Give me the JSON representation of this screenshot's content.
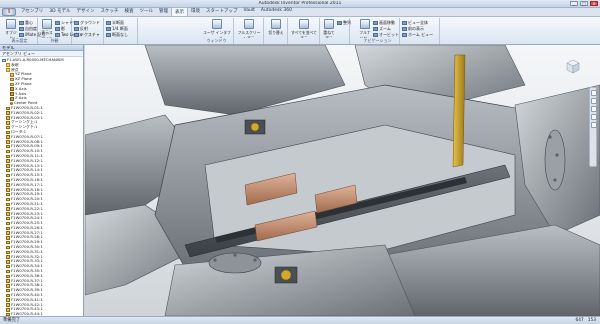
{
  "window": {
    "title": "Autodesk Inventor Professional 2011",
    "buttons": [
      "_",
      "□",
      "×"
    ]
  },
  "app_button": "I",
  "tabs": [
    "アセンブリ",
    "3D モデル",
    "デザイン",
    "スケッチ",
    "検査",
    "ツール",
    "管理",
    "表示",
    "環境",
    "スタートアップ",
    "Vault",
    "Autodesk 360"
  ],
  "active_tab": "表示",
  "ribbon": {
    "groups": [
      {
        "label": "表示設定",
        "big": "オブジェクトの可視性",
        "small": [
          "重心",
          "自由度",
          "iMate 記号"
        ]
      },
      {
        "label": "外観",
        "big": "表示スタイル",
        "small": [
          "シャドウ",
          "影",
          "Two Lights"
        ]
      },
      {
        "label": "",
        "big": "",
        "small": [
          "グラウンド",
          "反射",
          "テクスチャ"
        ]
      },
      {
        "label": "",
        "big": "",
        "small": [
          "半断面",
          "1/4 断面",
          "断面なし"
        ]
      },
      {
        "label": "ウィンドウ",
        "big": "ユーザ インタフェース",
        "small": []
      },
      {
        "label": "",
        "big": "フルスクリーン表示",
        "small": []
      },
      {
        "label": "",
        "big": "切り替え",
        "small": []
      },
      {
        "label": "",
        "big": "すべてを並べて表示",
        "small": []
      },
      {
        "label": "",
        "big": "重ねて表示",
        "small": [
          "整列"
        ]
      },
      {
        "label": "ナビゲーション",
        "big": "フルナビゲーションホイール",
        "small": [
          "画面移動",
          "ズーム",
          "オービット"
        ]
      },
      {
        "label": "",
        "big": "",
        "small": [
          "ビュー全体",
          "前の表示",
          "ホーム ビュー"
        ]
      }
    ]
  },
  "browser": {
    "title": "モデル",
    "view_selector": "アセンブリ ビュー",
    "tree": [
      {
        "label": "F1-kW1-A-R0000-MECHANISM",
        "icon": "assy",
        "indent": 0
      },
      {
        "label": "表現",
        "icon": "folder",
        "indent": 1
      },
      {
        "label": "原点",
        "icon": "folder",
        "indent": 1
      },
      {
        "label": "YZ Plane",
        "icon": "plane",
        "indent": 2
      },
      {
        "label": "XZ Plane",
        "icon": "plane",
        "indent": 2
      },
      {
        "label": "XY Plane",
        "icon": "plane",
        "indent": 2
      },
      {
        "label": "X Axis",
        "icon": "axis",
        "indent": 2
      },
      {
        "label": "Y Axis",
        "icon": "axis",
        "indent": 2
      },
      {
        "label": "Z Axis",
        "icon": "axis",
        "indent": 2
      },
      {
        "label": "Center Point",
        "icon": "point",
        "indent": 2
      },
      {
        "label": "F1W0700-R-01:1",
        "icon": "part",
        "indent": 1
      },
      {
        "label": "F1W0700-R-02:1",
        "icon": "part",
        "indent": 1
      },
      {
        "label": "F1W0700-R-03:1",
        "icon": "part",
        "indent": 1
      },
      {
        "label": "ケーシング上:1",
        "icon": "part",
        "indent": 1
      },
      {
        "label": "ケーシング下:1",
        "icon": "part",
        "indent": 1
      },
      {
        "label": "ロータ:1",
        "icon": "part",
        "indent": 1
      },
      {
        "label": "F1W0700-R-07:1",
        "icon": "part",
        "indent": 1
      },
      {
        "label": "F1W0700-R-08:1",
        "icon": "part",
        "indent": 1
      },
      {
        "label": "F1W0700-R-09:1",
        "icon": "part",
        "indent": 1
      },
      {
        "label": "F1W0700-R-10:1",
        "icon": "part",
        "indent": 1
      },
      {
        "label": "F1W0700-R-11:1",
        "icon": "part",
        "indent": 1
      },
      {
        "label": "F1W0700-R-12:1",
        "icon": "part",
        "indent": 1
      },
      {
        "label": "F1W0700-R-13:1",
        "icon": "part",
        "indent": 1
      },
      {
        "label": "F1W0700-R-14:1",
        "icon": "part",
        "indent": 1
      },
      {
        "label": "F1W0700-R-15:1",
        "icon": "part",
        "indent": 1
      },
      {
        "label": "F1W0700-R-16:1",
        "icon": "part",
        "indent": 1
      },
      {
        "label": "F1W0700-R-17:1",
        "icon": "part",
        "indent": 1
      },
      {
        "label": "F1W0700-R-18:1",
        "icon": "part",
        "indent": 1
      },
      {
        "label": "F1W0700-R-19:1",
        "icon": "part",
        "indent": 1
      },
      {
        "label": "F1W0700-R-20:1",
        "icon": "part",
        "indent": 1
      },
      {
        "label": "F1W0700-R-21:1",
        "icon": "part",
        "indent": 1
      },
      {
        "label": "F1W0700-R-22:1",
        "icon": "part",
        "indent": 1
      },
      {
        "label": "F1W0700-R-23:1",
        "icon": "part",
        "indent": 1
      },
      {
        "label": "F1W0700-R-24:1",
        "icon": "part",
        "indent": 1
      },
      {
        "label": "F1W0700-R-25:1",
        "icon": "part",
        "indent": 1
      },
      {
        "label": "F1W0700-R-26:1",
        "icon": "part",
        "indent": 1
      },
      {
        "label": "F1W0700-R-27:1",
        "icon": "part",
        "indent": 1
      },
      {
        "label": "F1W0700-R-28:1",
        "icon": "part",
        "indent": 1
      },
      {
        "label": "F1W0700-R-29:1",
        "icon": "part",
        "indent": 1
      },
      {
        "label": "F1W0700-R-30:1",
        "icon": "part",
        "indent": 1
      },
      {
        "label": "F1W0700-R-31:1",
        "icon": "part",
        "indent": 1
      },
      {
        "label": "F1W0700-R-32:1",
        "icon": "part",
        "indent": 1
      },
      {
        "label": "F1W0700-R-33:1",
        "icon": "part",
        "indent": 1
      },
      {
        "label": "F1W0700-R-34:1",
        "icon": "part",
        "indent": 1
      },
      {
        "label": "F1W0700-R-35:1",
        "icon": "part",
        "indent": 1
      },
      {
        "label": "F1W0700-R-36:1",
        "icon": "part",
        "indent": 1
      },
      {
        "label": "F1W0700-R-37:1",
        "icon": "part",
        "indent": 1
      },
      {
        "label": "F1W0700-R-38:1",
        "icon": "part",
        "indent": 1
      },
      {
        "label": "F1W0700-R-39:1",
        "icon": "part",
        "indent": 1
      },
      {
        "label": "F1W0700-R-40:1",
        "icon": "part",
        "indent": 1
      },
      {
        "label": "F1W0700-R-41:1",
        "icon": "part",
        "indent": 1
      },
      {
        "label": "F1W0700-R-42:1",
        "icon": "part",
        "indent": 1
      },
      {
        "label": "F1W0700-R-43:1",
        "icon": "part",
        "indent": 1
      },
      {
        "label": "F1W0700-R-44:1",
        "icon": "part",
        "indent": 1
      },
      {
        "label": "F1W0700-R-45:1",
        "icon": "part",
        "indent": 1
      }
    ]
  },
  "status": {
    "left": "準備完了",
    "right_a": "647",
    "right_b": "153"
  },
  "colors": {
    "accent": "#2e5b94",
    "steel": "#8f969d",
    "copper": "#c08a6a"
  }
}
